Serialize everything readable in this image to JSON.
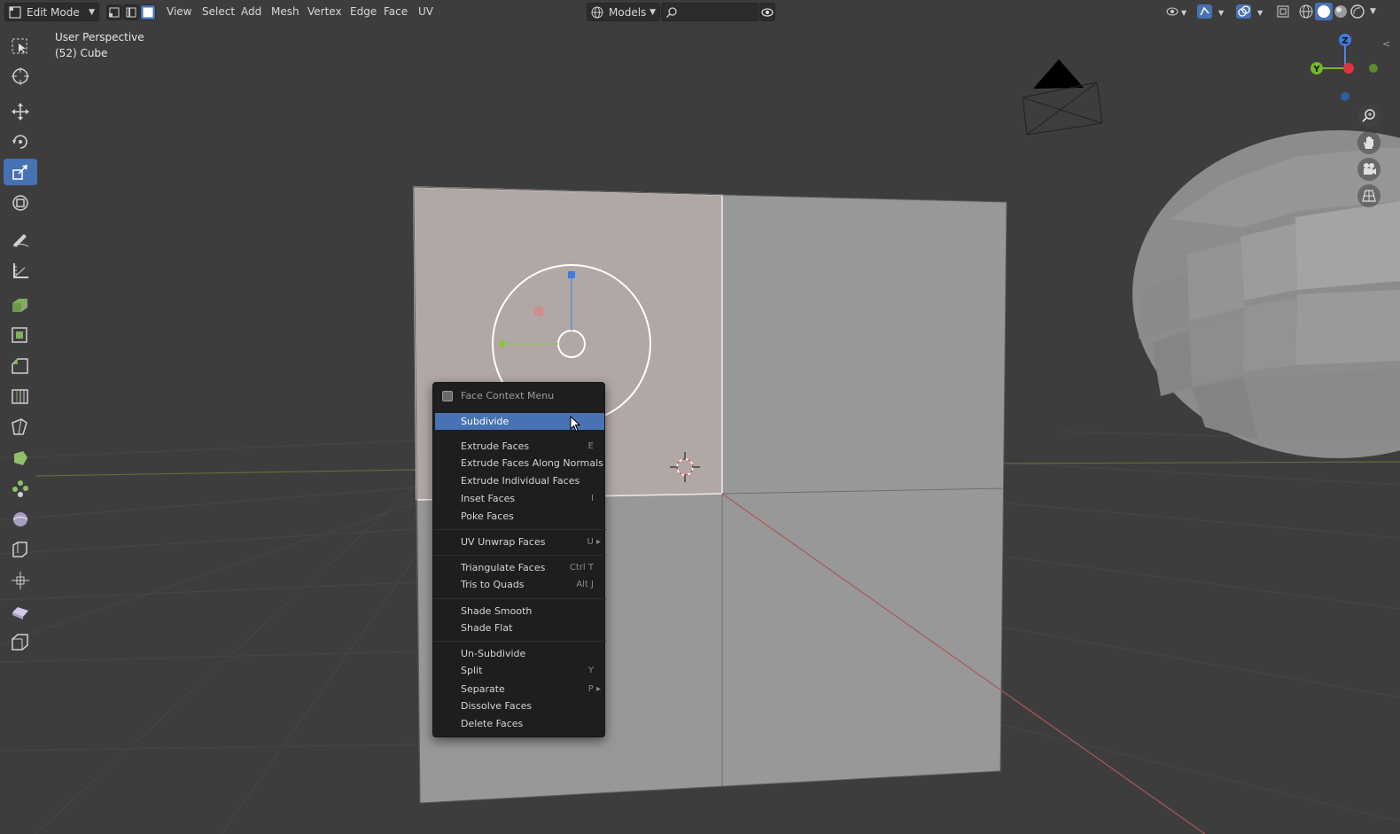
{
  "header": {
    "mode": "Edit Mode",
    "menus": [
      "View",
      "Select",
      "Add",
      "Mesh",
      "Vertex",
      "Edge",
      "Face",
      "UV"
    ],
    "orientation": "Models",
    "search_placeholder": ""
  },
  "viewport": {
    "view_name": "User Perspective",
    "object_label": "(52) Cube",
    "axis_labels": {
      "z": "Z",
      "y": "Y"
    }
  },
  "context_menu": {
    "title": "Face Context Menu",
    "items": [
      {
        "label": "Subdivide",
        "shortcut": ""
      },
      {
        "label": "Extrude Faces",
        "shortcut": "E"
      },
      {
        "label": "Extrude Faces Along Normals",
        "shortcut": ""
      },
      {
        "label": "Extrude Individual Faces",
        "shortcut": ""
      },
      {
        "label": "Inset Faces",
        "shortcut": "I"
      },
      {
        "label": "Poke Faces",
        "shortcut": ""
      },
      {
        "label": "UV Unwrap Faces",
        "shortcut": "U"
      },
      {
        "label": "Triangulate Faces",
        "shortcut": "Ctrl T"
      },
      {
        "label": "Tris to Quads",
        "shortcut": "Alt J"
      },
      {
        "label": "Shade Smooth",
        "shortcut": ""
      },
      {
        "label": "Shade Flat",
        "shortcut": ""
      },
      {
        "label": "Un-Subdivide",
        "shortcut": ""
      },
      {
        "label": "Split",
        "shortcut": "Y"
      },
      {
        "label": "Separate",
        "shortcut": "P"
      },
      {
        "label": "Dissolve Faces",
        "shortcut": ""
      },
      {
        "label": "Delete Faces",
        "shortcut": ""
      }
    ]
  },
  "colors": {
    "accent": "#4772b3",
    "background": "#3d3d3d",
    "menu_bg": "#1e1e1e"
  },
  "icons": {
    "toolbar": [
      "select-box-icon",
      "cursor-icon",
      "move-icon",
      "rotate-icon",
      "scale-icon",
      "transform-icon",
      "annotate-icon",
      "measure-icon",
      "extrude-region-icon",
      "inset-faces-icon",
      "bevel-icon",
      "loop-cut-icon",
      "knife-icon",
      "poly-build-icon",
      "spin-icon",
      "smooth-icon",
      "edge-slide-icon",
      "shrink-fatten-icon",
      "shear-icon",
      "rip-region-icon"
    ],
    "nav": [
      "zoom-icon",
      "pan-icon",
      "camera-icon",
      "ortho-grid-icon"
    ]
  }
}
